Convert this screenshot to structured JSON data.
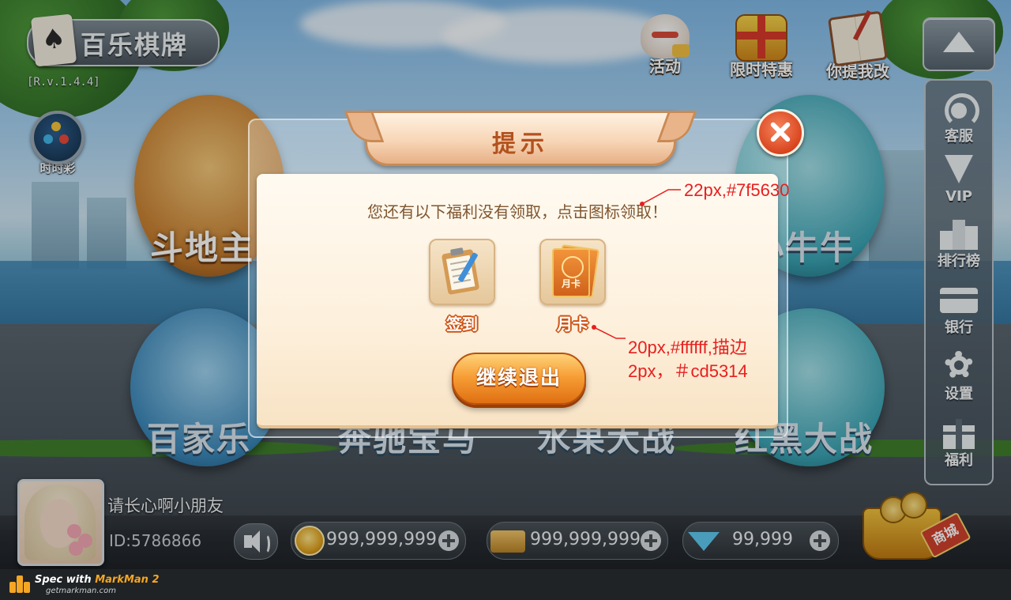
{
  "app": {
    "logo_text": "百乐棋牌",
    "version": "[R.v.1.4.4]"
  },
  "lottery": {
    "label": "时时彩"
  },
  "top_icons": [
    {
      "label": "活动",
      "icon": "lucky-cat-icon"
    },
    {
      "label": "限时特惠",
      "icon": "gift-box-icon"
    },
    {
      "label": "你提我改",
      "icon": "book-pen-icon"
    }
  ],
  "sidebar": {
    "up_icon": "arrow-up-icon",
    "items": [
      {
        "label": "客服",
        "icon": "headset-icon"
      },
      {
        "label": "VIP",
        "icon": "vip-diamond-icon"
      },
      {
        "label": "排行榜",
        "icon": "podium-icon"
      },
      {
        "label": "银行",
        "icon": "bank-card-icon"
      },
      {
        "label": "设置",
        "icon": "gear-icon"
      },
      {
        "label": "福利",
        "icon": "gift-icon"
      }
    ]
  },
  "games": [
    {
      "label": "斗地主"
    },
    {
      "label": "小牛牛"
    },
    {
      "label": "百家乐"
    },
    {
      "label": "奔驰宝马"
    },
    {
      "label": "水果大战"
    },
    {
      "label": "红黑大战"
    }
  ],
  "dialog": {
    "title": "提示",
    "message": "您还有以下福利没有领取，点击图标领取！",
    "rewards": [
      {
        "label": "签到",
        "icon": "clipboard-checkin-icon"
      },
      {
        "label": "月卡",
        "icon": "monthly-card-icon",
        "card_text": "月卡"
      }
    ],
    "continue_label": "继续退出",
    "close_icon": "close-icon"
  },
  "user": {
    "nickname": "请长心啊小朋友",
    "id": "ID:5786866"
  },
  "currencies": [
    {
      "icon": "gold-coin-icon",
      "value": "999,999,999"
    },
    {
      "icon": "bank-card-icon",
      "value": "999,999,999"
    },
    {
      "icon": "diamond-icon",
      "value": "99,999"
    }
  ],
  "shop": {
    "label": "商城",
    "icon": "shop-basket-icon"
  },
  "annotations": {
    "message_spec": "22px,#7f5630",
    "label_spec_line1": "20px,#ffffff,描边",
    "label_spec_line2": "2px，＃cd5314"
  },
  "footer": {
    "title_prefix": "Spec with",
    "title_brand": "MarkMan 2",
    "url": "getmarkman.com"
  },
  "colors": {
    "message_text": "#7f5630",
    "label_stroke": "#cd5314",
    "annotation": "#e81f1f"
  }
}
